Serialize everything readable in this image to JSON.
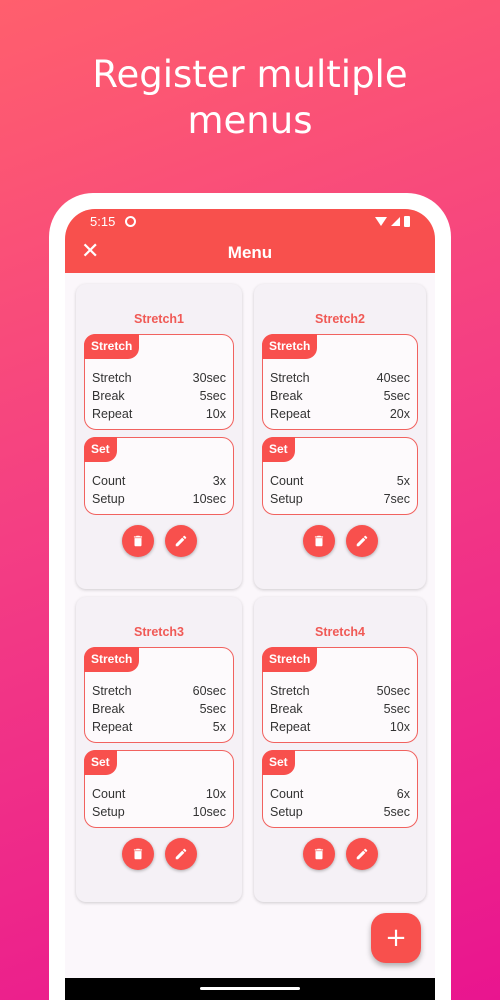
{
  "headline": {
    "line1": "Register multiple",
    "line2": "menus"
  },
  "status": {
    "time": "5:15"
  },
  "appbar": {
    "close_icon": "✕",
    "title": "Menu"
  },
  "colors": {
    "accent": "#f8504d",
    "title_text": "#f05a56"
  },
  "cards": [
    {
      "name": "Stretch1",
      "stretch": {
        "label": "Stretch",
        "rows": [
          {
            "k": "Stretch",
            "v": "30sec"
          },
          {
            "k": "Break",
            "v": "5sec"
          },
          {
            "k": "Repeat",
            "v": "10x"
          }
        ]
      },
      "set": {
        "label": "Set",
        "rows": [
          {
            "k": "Count",
            "v": "3x"
          },
          {
            "k": "Setup",
            "v": "10sec"
          }
        ]
      }
    },
    {
      "name": "Stretch2",
      "stretch": {
        "label": "Stretch",
        "rows": [
          {
            "k": "Stretch",
            "v": "40sec"
          },
          {
            "k": "Break",
            "v": "5sec"
          },
          {
            "k": "Repeat",
            "v": "20x"
          }
        ]
      },
      "set": {
        "label": "Set",
        "rows": [
          {
            "k": "Count",
            "v": "5x"
          },
          {
            "k": "Setup",
            "v": "7sec"
          }
        ]
      }
    },
    {
      "name": "Stretch3",
      "stretch": {
        "label": "Stretch",
        "rows": [
          {
            "k": "Stretch",
            "v": "60sec"
          },
          {
            "k": "Break",
            "v": "5sec"
          },
          {
            "k": "Repeat",
            "v": "5x"
          }
        ]
      },
      "set": {
        "label": "Set",
        "rows": [
          {
            "k": "Count",
            "v": "10x"
          },
          {
            "k": "Setup",
            "v": "10sec"
          }
        ]
      }
    },
    {
      "name": "Stretch4",
      "stretch": {
        "label": "Stretch",
        "rows": [
          {
            "k": "Stretch",
            "v": "50sec"
          },
          {
            "k": "Break",
            "v": "5sec"
          },
          {
            "k": "Repeat",
            "v": "10x"
          }
        ]
      },
      "set": {
        "label": "Set",
        "rows": [
          {
            "k": "Count",
            "v": "6x"
          },
          {
            "k": "Setup",
            "v": "5sec"
          }
        ]
      }
    }
  ],
  "fab": {
    "icon": "+"
  }
}
